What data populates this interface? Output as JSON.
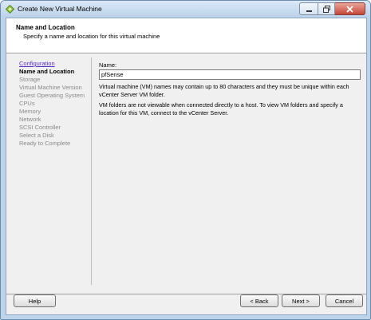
{
  "window": {
    "title": "Create New Virtual Machine",
    "icon": "vm-wizard-icon"
  },
  "header": {
    "title": "Name and Location",
    "subtitle": "Specify a name and location for this virtual machine"
  },
  "steps": [
    {
      "label": "Configuration",
      "state": "link"
    },
    {
      "label": "Name and Location",
      "state": "current"
    },
    {
      "label": "Storage",
      "state": "pending"
    },
    {
      "label": "Virtual Machine Version",
      "state": "pending"
    },
    {
      "label": "Guest Operating System",
      "state": "pending"
    },
    {
      "label": "CPUs",
      "state": "pending"
    },
    {
      "label": "Memory",
      "state": "pending"
    },
    {
      "label": "Network",
      "state": "pending"
    },
    {
      "label": "SCSI Controller",
      "state": "pending"
    },
    {
      "label": "Select a Disk",
      "state": "pending"
    },
    {
      "label": "Ready to Complete",
      "state": "pending"
    }
  ],
  "form": {
    "name_label": "Name:",
    "name_value": "pfSense",
    "info1": "Virtual machine (VM) names may contain up to 80 characters and they must be unique within each vCenter Server VM folder.",
    "info2": "VM folders are not viewable when connected directly to a host. To view VM folders and specify a location for this VM, connect to the vCenter Server."
  },
  "buttons": {
    "help": "Help",
    "back": "< Back",
    "next": "Next >",
    "cancel": "Cancel"
  }
}
